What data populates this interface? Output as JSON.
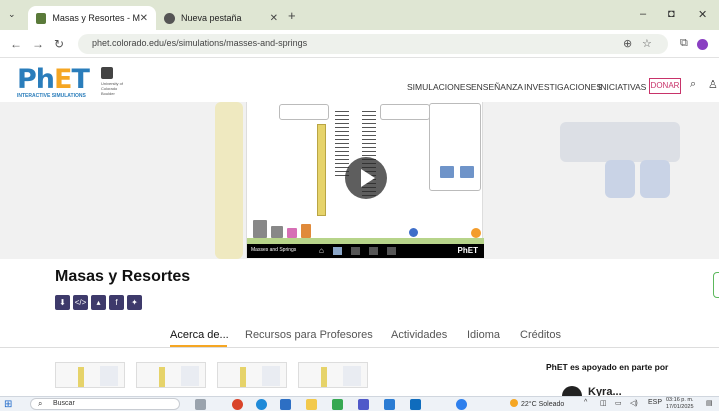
{
  "browser": {
    "tabs": [
      {
        "title": "Masas y Resortes - Movimiento",
        "active": true
      },
      {
        "title": "Nueva pestaña",
        "active": false
      }
    ],
    "new_tab_symbol": "+",
    "url": "phet.colorado.edu/es/simulations/masses-and-springs",
    "window_controls": [
      "–",
      "◘",
      "✕"
    ]
  },
  "header": {
    "logo_text": "PhET",
    "logo_subtitle": "INTERACTIVE SIMULATIONS",
    "university_text": "University of Colorado Boulder",
    "nav": [
      "SIMULACIONES",
      "ENSEÑANZA",
      "INVESTIGACIONES",
      "INICIATIVAS"
    ],
    "donate": "DONAR"
  },
  "simulation": {
    "title_bar": "Masses and Springs",
    "brand": "PhET"
  },
  "page": {
    "sim_name": "Masas y Resortes",
    "tabs": [
      "Acerca de...",
      "Recursos para Profesores",
      "Actividades",
      "Idioma",
      "Créditos"
    ],
    "active_tab": "Acerca de...",
    "supported_by": "PhET es apoyado en parte por",
    "sponsor_partial": "Kyra..."
  },
  "taskbar": {
    "search_placeholder": "Buscar",
    "weather": "22°C Soleado",
    "language": "ESP",
    "time": "03:16 p. m.",
    "date": "17/01/2025"
  },
  "colors": {
    "phet_blue": "#2a7dbb",
    "phet_orange": "#f5a623",
    "donate_pink": "#c8336a",
    "share_purple": "#3e3a6b"
  }
}
